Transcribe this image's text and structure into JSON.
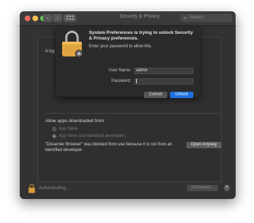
{
  "window": {
    "title": "Security & Privacy",
    "search_placeholder": "Search",
    "nav_back": "‹",
    "nav_forward": "›",
    "traffic_lights": [
      "#ed6a5e",
      "#f5bf4f",
      "#62c655"
    ]
  },
  "general": {
    "login_text_partial": "A log",
    "allow_title": "Allow apps downloaded from:",
    "options": [
      {
        "label": "App Store",
        "selected": false
      },
      {
        "label": "App Store and identified developers",
        "selected": true
      }
    ],
    "blocked_message": "\"Dissenter Browser\" was blocked from use because it is not from an identified developer.",
    "open_anyway": "Open Anyway"
  },
  "footer": {
    "authenticating": "Authenticating...",
    "advanced": "Advanced...",
    "help": "?"
  },
  "dialog": {
    "title": "System Preferences is trying to unlock Security & Privacy preferences.",
    "subtitle": "Enter your password to allow this.",
    "username_label": "User Name:",
    "username_value": "admin",
    "password_label": "Password:",
    "password_value": "",
    "cancel": "Cancel",
    "unlock": "Unlock"
  },
  "colors": {
    "accent": "#1f6fe0",
    "lock_gold": "#e0a440"
  }
}
